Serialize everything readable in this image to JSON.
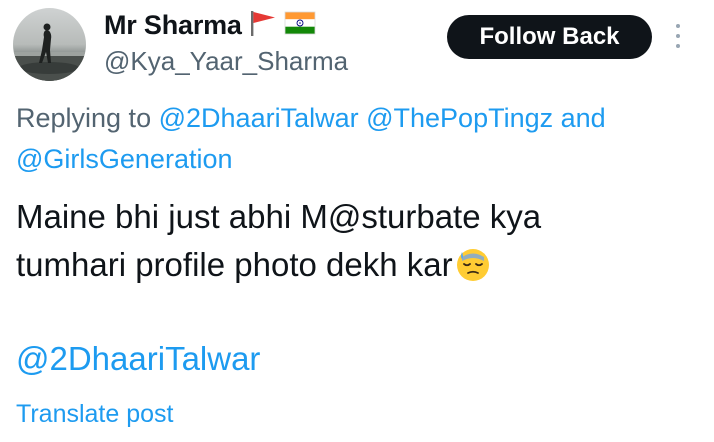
{
  "author": {
    "name": "Mr Sharma",
    "handle": "@Kya_Yaar_Sharma",
    "avatar_icon": "profile-avatar-sunset-silhouette",
    "flag_icons": [
      "red-flag-icon",
      "india-flag-icon"
    ]
  },
  "header": {
    "follow_button_label": "Follow Back",
    "more_icon": "more-vertical-icon"
  },
  "reply": {
    "prefix": "Replying to",
    "mentions": [
      "@2DhaariTalwar",
      "@ThePopTingz"
    ],
    "conjunction": "and",
    "last_mention": "@GirlsGeneration"
  },
  "post": {
    "line1": "Maine bhi just abhi M@sturbate kya",
    "line2": "tumhari profile photo dekh kar",
    "emoji_icon": "downcast-face-with-sweat-emoji",
    "tag": "@2DhaariTalwar",
    "translate_label": "Translate post"
  },
  "colors": {
    "text": "#0f1419",
    "secondary": "#536471",
    "link": "#1d9bf0",
    "button_bg": "#0f1419"
  }
}
